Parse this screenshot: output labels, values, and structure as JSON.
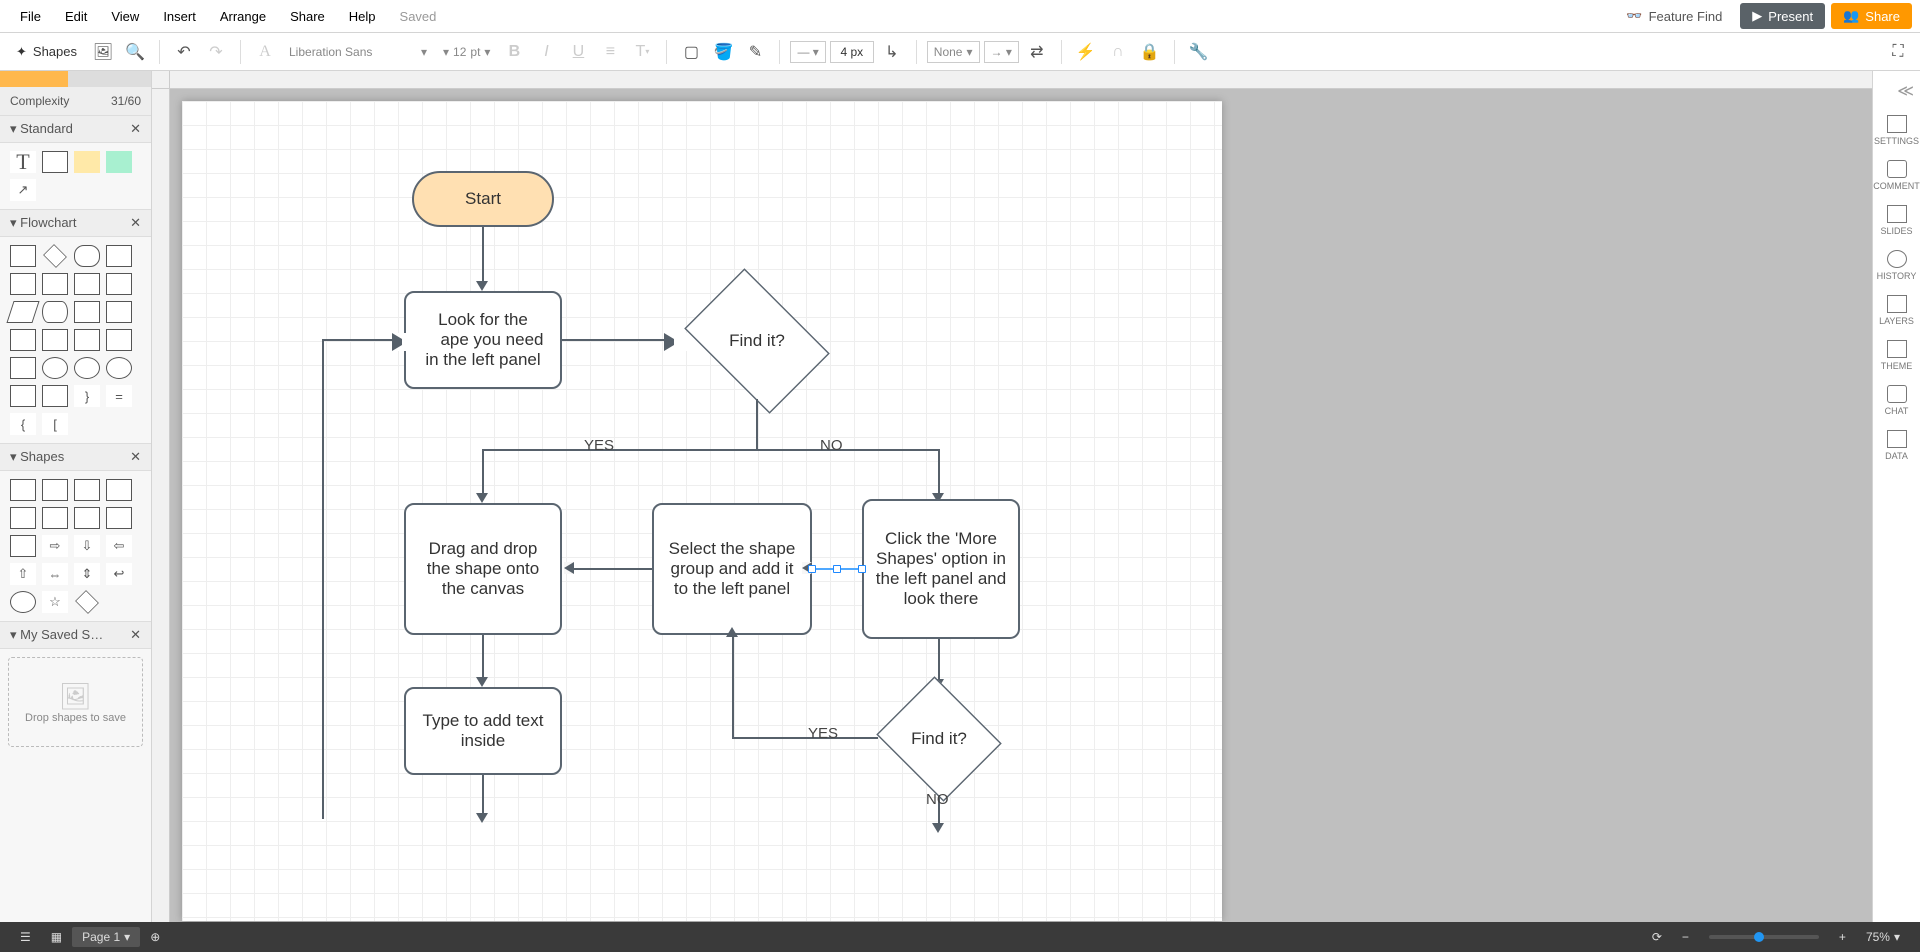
{
  "menu": {
    "file": "File",
    "edit": "Edit",
    "view": "View",
    "insert": "Insert",
    "arrange": "Arrange",
    "share": "Share",
    "help": "Help",
    "saved": "Saved",
    "feature_find": "Feature Find",
    "present": "Present",
    "share_btn": "Share"
  },
  "toolbar": {
    "shapes": "Shapes",
    "font": "Liberation Sans",
    "size": "12",
    "size_unit": "pt",
    "line_width": "4 px",
    "fill_label": "None"
  },
  "left": {
    "complexity_label": "Complexity",
    "complexity_value": "31/60",
    "group_standard": "Standard",
    "group_flowchart": "Flowchart",
    "group_shapes": "Shapes",
    "group_saved": "My Saved S…",
    "drop_hint": "Drop shapes to save"
  },
  "canvas": {
    "nodes": {
      "start": "Start",
      "look": "Look for the shape you need in the left panel",
      "find1": "Find it?",
      "drag": "Drag and drop the shape onto the canvas",
      "select": "Select the shape group and add it to the left panel",
      "more": "Click the 'More Shapes' option in the left panel and look there",
      "type": "Type to add text inside",
      "find2": "Find it?",
      "yes": "YES",
      "no": "NO"
    }
  },
  "right": {
    "settings": "SETTINGS",
    "comment": "COMMENT",
    "slides": "SLIDES",
    "history": "HISTORY",
    "layers": "LAYERS",
    "theme": "THEME",
    "chat": "CHAT",
    "data": "DATA"
  },
  "bottom": {
    "page": "Page 1",
    "zoom": "75%"
  }
}
